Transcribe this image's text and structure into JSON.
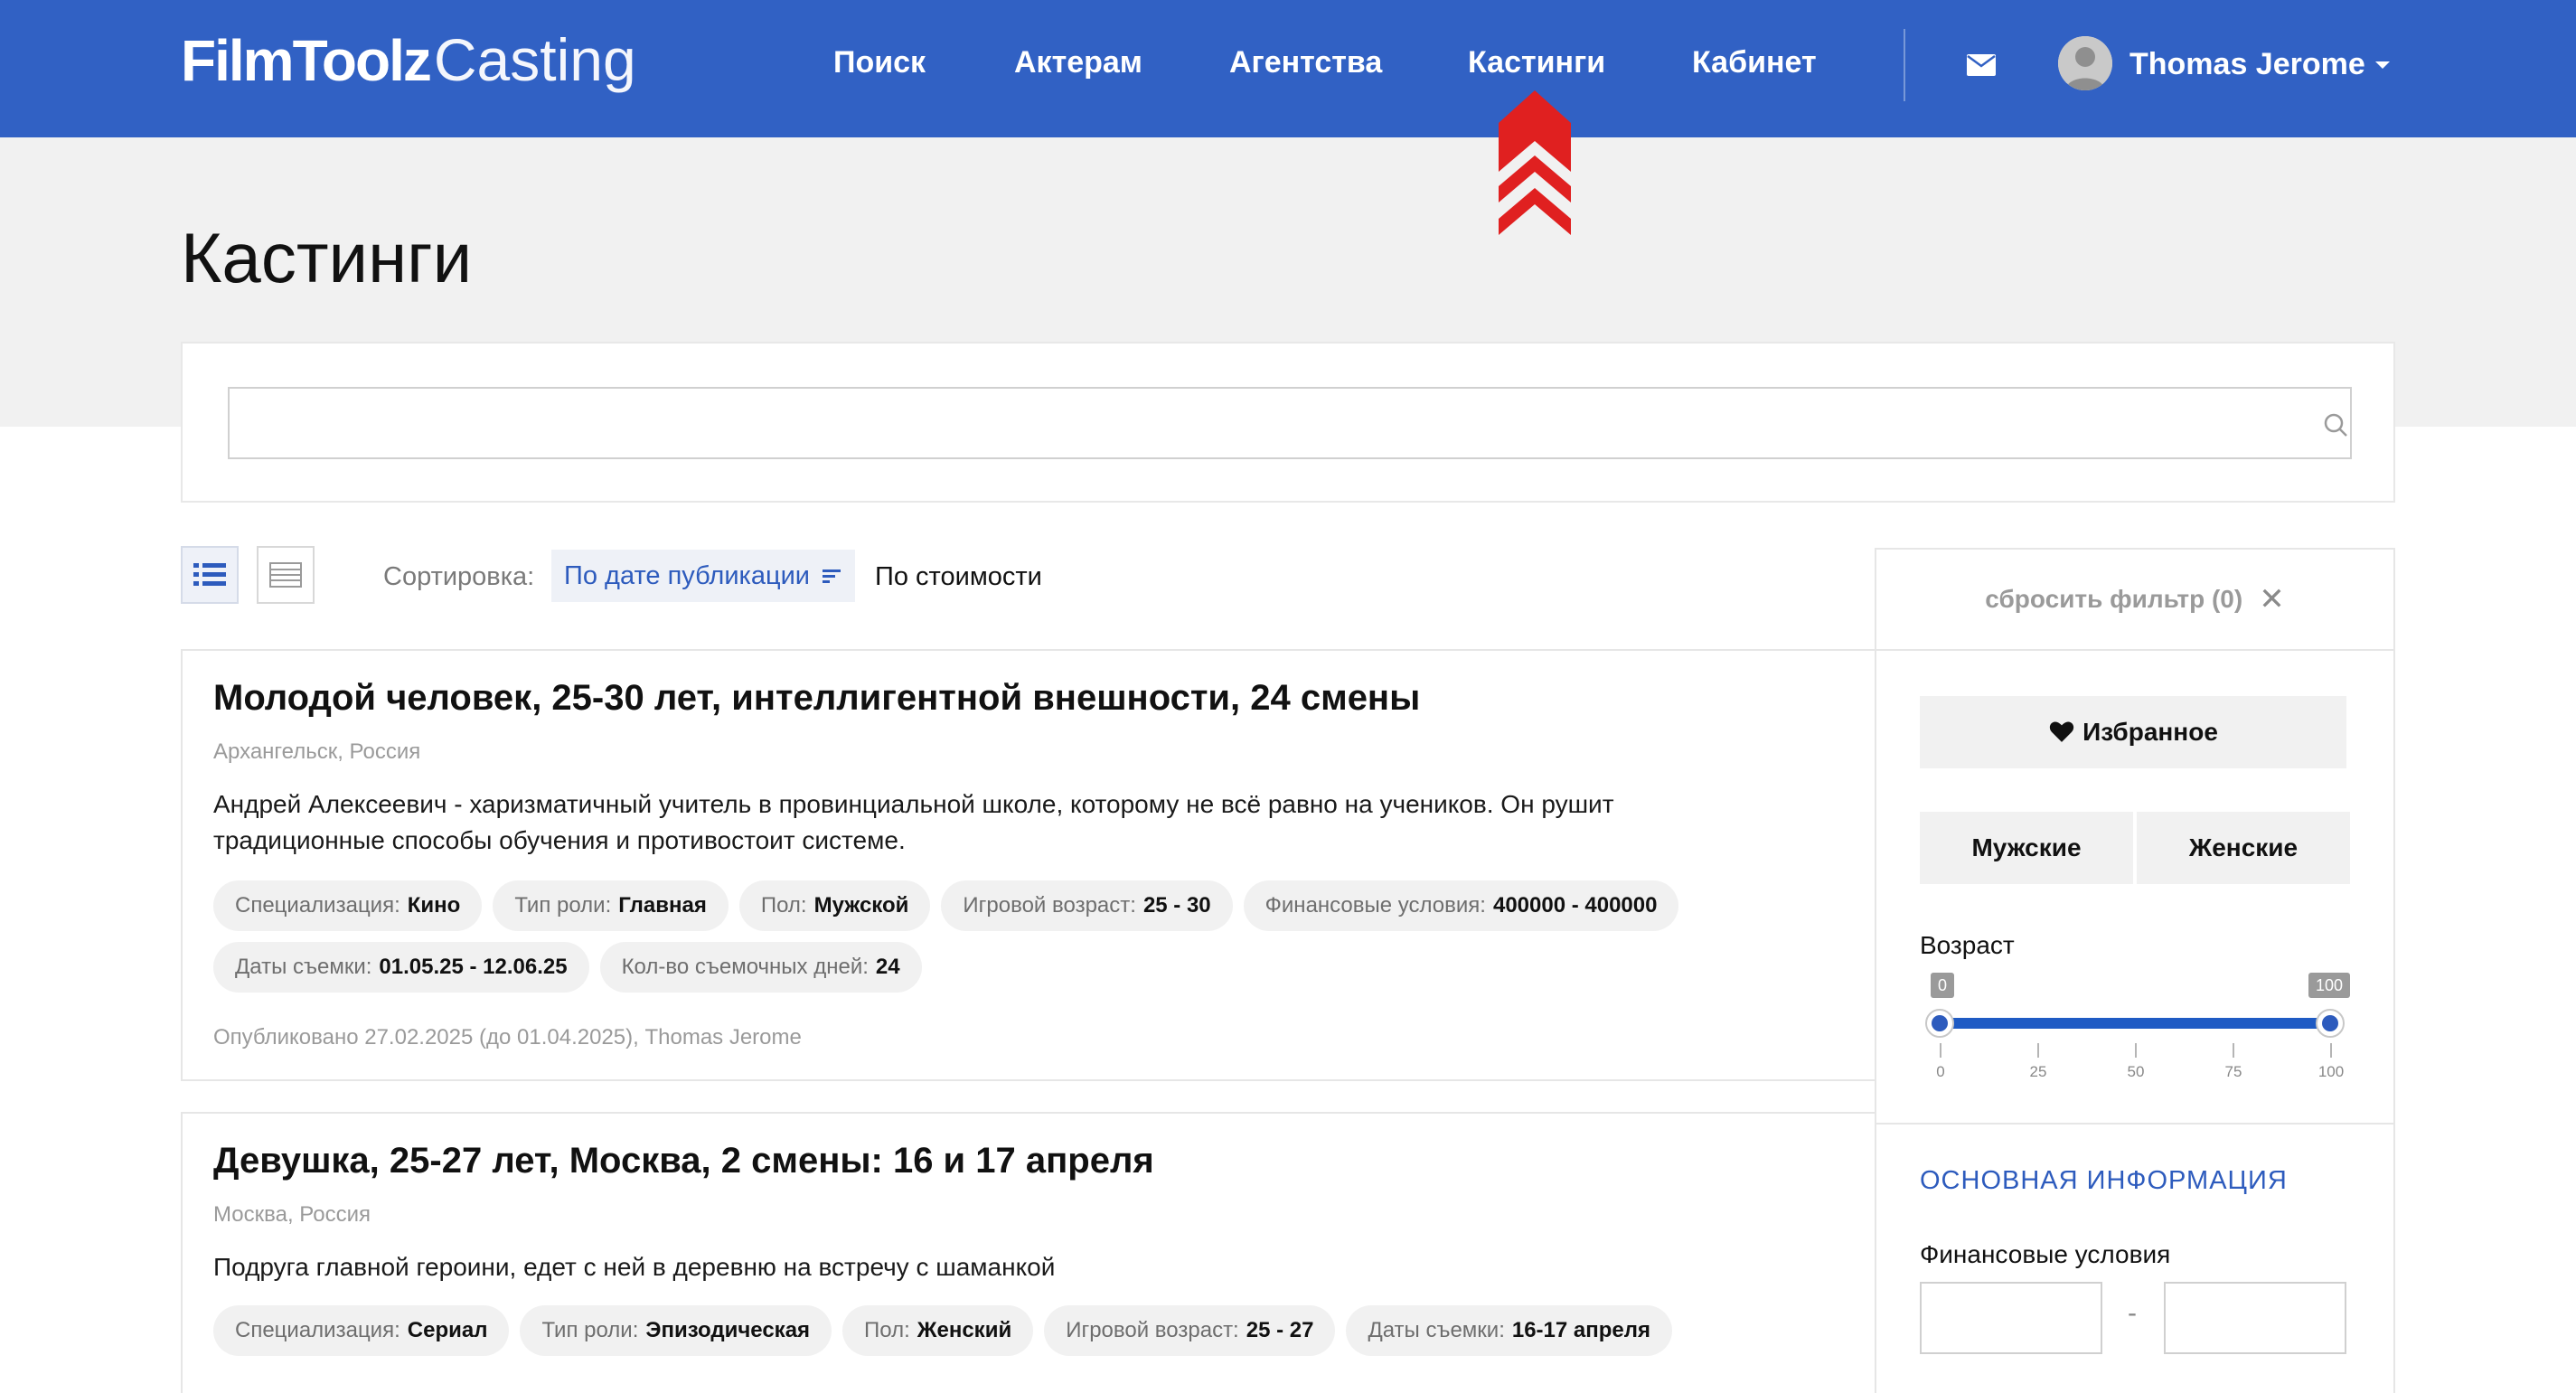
{
  "brand": {
    "bold": "FilmToolz",
    "light": "Casting"
  },
  "nav": [
    {
      "label": "Поиск"
    },
    {
      "label": "Актерам"
    },
    {
      "label": "Агентства"
    },
    {
      "label": "Кастинги"
    },
    {
      "label": "Кабинет"
    }
  ],
  "user": {
    "name": "Thomas Jerome"
  },
  "page": {
    "title": "Кастинги"
  },
  "search": {
    "value": "",
    "placeholder": ""
  },
  "toolbar": {
    "sort_label": "Сортировка:",
    "sort_active": "По дате публикации",
    "sort_other": "По стоимости"
  },
  "castings": [
    {
      "title": "Молодой человек, 25-30 лет, интеллигентной внешности, 24 смены",
      "location": "Архангельск, Россия",
      "description": "Андрей Алексеевич - харизматичный учитель в провинциальной школе, которому не всё равно на учеников. Он рушит традиционные способы обучения и противостоит системе.",
      "tags": [
        {
          "label": "Специализация:",
          "value": "Кино"
        },
        {
          "label": "Тип роли:",
          "value": "Главная"
        },
        {
          "label": "Пол:",
          "value": "Мужской"
        },
        {
          "label": "Игровой возраст:",
          "value": "25 - 30"
        },
        {
          "label": "Финансовые условия:",
          "value": "400000 - 400000"
        },
        {
          "label": "Даты съемки:",
          "value": "01.05.25 - 12.06.25"
        },
        {
          "label": "Кол-во съемочных дней:",
          "value": "24"
        }
      ],
      "footer": "Опубликовано 27.02.2025 (до 01.04.2025), Thomas Jerome"
    },
    {
      "title": "Девушка, 25-27 лет, Москва, 2 смены: 16 и 17 апреля",
      "location": "Москва, Россия",
      "description": "Подруга главной героини, едет с ней в деревню на встречу с шаманкой",
      "tags": [
        {
          "label": "Специализация:",
          "value": "Сериал"
        },
        {
          "label": "Тип роли:",
          "value": "Эпизодическая"
        },
        {
          "label": "Пол:",
          "value": "Женский"
        },
        {
          "label": "Игровой возраст:",
          "value": "25 - 27"
        },
        {
          "label": "Даты съемки:",
          "value": "16-17 апреля"
        }
      ]
    }
  ],
  "filters": {
    "reset": "сбросить фильтр (0)",
    "favorites": "Избранное",
    "male": "Мужские",
    "female": "Женские",
    "age_label": "Возраст",
    "age_min": "0",
    "age_max": "100",
    "age_ticks": [
      "0",
      "25",
      "50",
      "75",
      "100"
    ],
    "section_title": "ОСНОВНАЯ ИНФОРМАЦИЯ",
    "finance_label": "Финансовые условия",
    "finance_dash": "-"
  },
  "colors": {
    "brand": "#3161c4",
    "accent": "#2d5bbd",
    "marker": "#e02020"
  }
}
